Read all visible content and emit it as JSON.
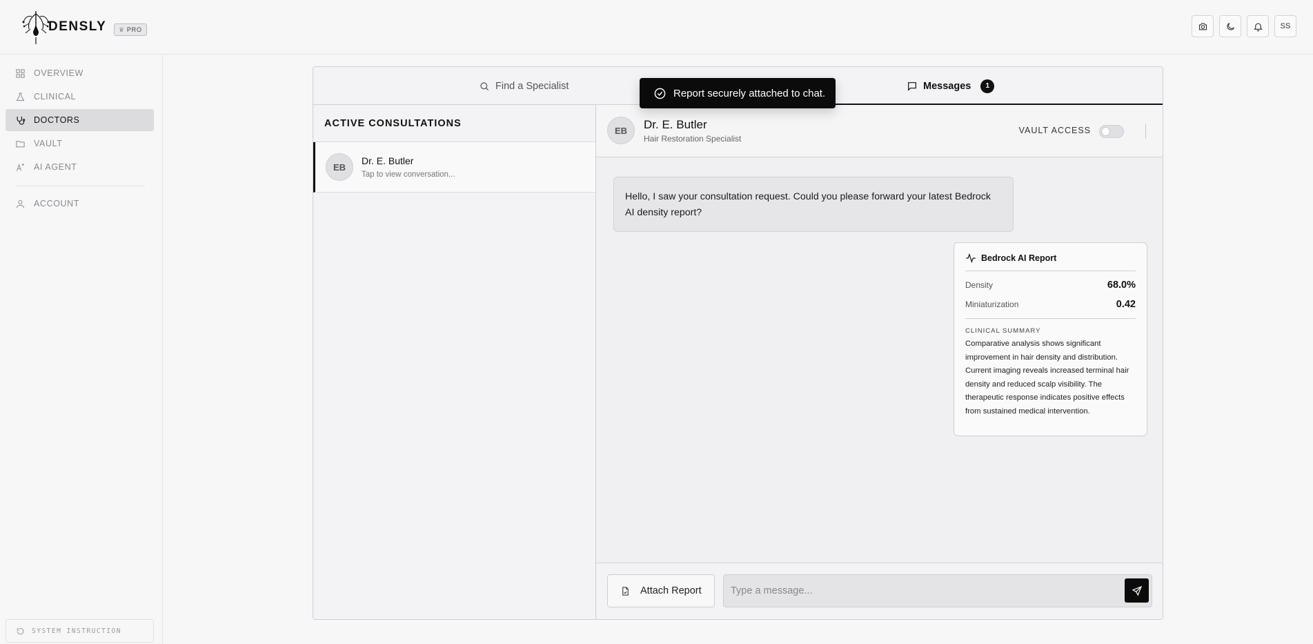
{
  "app": {
    "name": "DENSLY",
    "badge": "PRO"
  },
  "header": {
    "user_initials": "SS",
    "actions": [
      "camera-icon",
      "moon-icon",
      "bell-icon"
    ]
  },
  "sidebar": {
    "items": [
      {
        "label": "OVERVIEW",
        "icon": "grid-icon"
      },
      {
        "label": "CLINICAL",
        "icon": "flask-icon"
      },
      {
        "label": "DOCTORS",
        "icon": "stethoscope-icon",
        "active": true
      },
      {
        "label": "VAULT",
        "icon": "folder-icon"
      },
      {
        "label": "AI AGENT",
        "icon": "sparkle-icon"
      },
      {
        "label": "ACCOUNT",
        "icon": "user-icon"
      }
    ],
    "system_instruction": "SYSTEM INSTRUCTION"
  },
  "tabs": {
    "find": "Find a Specialist",
    "messages": "Messages",
    "messages_count": "1"
  },
  "toast": {
    "text": "Report securely attached to chat."
  },
  "consultations": {
    "heading": "ACTIVE CONSULTATIONS",
    "items": [
      {
        "initials": "EB",
        "name": "Dr. E. Butler",
        "sub": "Tap to view conversation..."
      }
    ]
  },
  "chat": {
    "initials": "EB",
    "name": "Dr. E. Butler",
    "role": "Hair Restoration Specialist",
    "vault_label": "VAULT ACCESS",
    "vault_access_on": false,
    "message": "Hello, I saw your consultation request. Could you please forward your latest Bedrock AI density report?",
    "report": {
      "title": "Bedrock AI Report",
      "metrics": [
        {
          "label": "Density",
          "value": "68.0%"
        },
        {
          "label": "Miniaturization",
          "value": "0.42"
        }
      ],
      "summary_label": "CLINICAL SUMMARY",
      "summary": "Comparative analysis shows significant improvement in hair density and distribution. Current imaging reveals increased terminal hair density and reduced scalp visibility. The therapeutic response indicates positive effects from sustained medical intervention."
    }
  },
  "composer": {
    "attach_label": "Attach Report",
    "placeholder": "Type a message..."
  }
}
